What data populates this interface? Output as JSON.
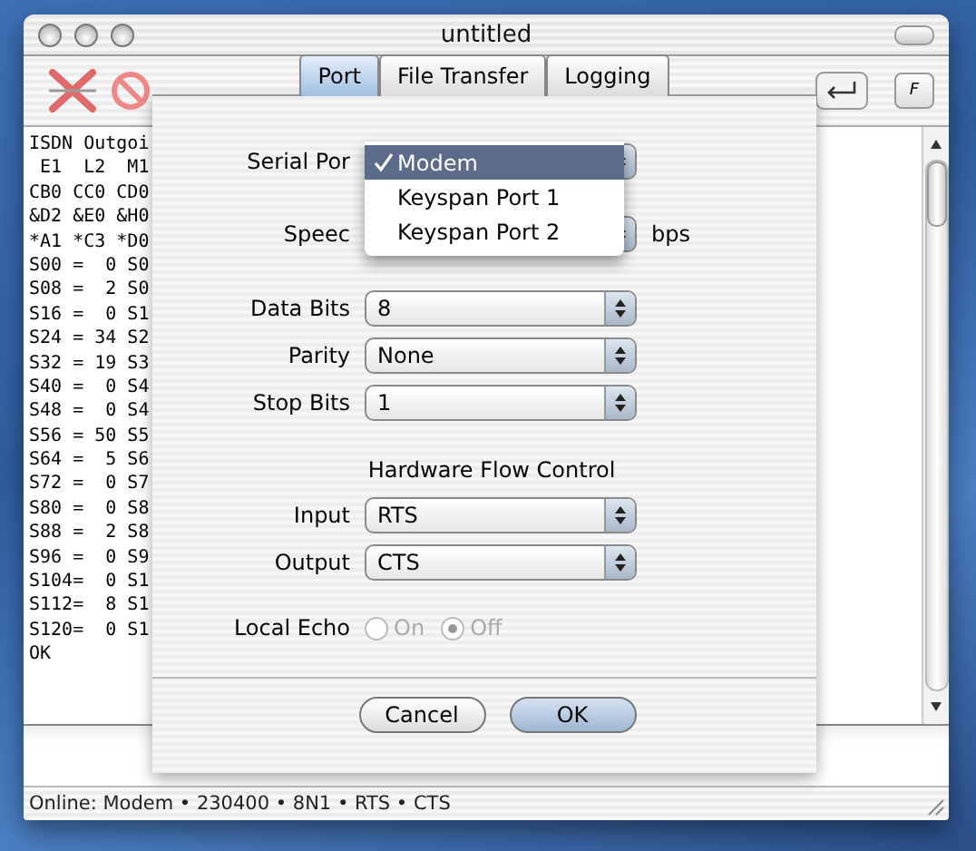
{
  "window": {
    "title": "untitled"
  },
  "toolbar": {
    "key_label": "F"
  },
  "terminal": {
    "lines": [
      "ISDN Outgoi",
      " E1  L2  M1",
      "CB0 CC0 CD0",
      "&D2 &E0 &H0",
      "*A1 *C3 *D0",
      "S00 =  0 S0",
      "S08 =  2 S0",
      "S16 =  0 S1",
      "S24 = 34 S2",
      "S32 = 19 S3",
      "S40 =  0 S4",
      "S48 =  0 S4",
      "S56 = 50 S5",
      "S64 =  5 S6",
      "S72 =  0 S7",
      "S80 =  0 S8",
      "S88 =  2 S8",
      "S96 =  0 S9",
      "S104=  0 S1",
      "S112=  8 S1",
      "S120=  0 S1",
      "OK"
    ]
  },
  "status_bar": "Online: Modem • 230400 • 8N1 • RTS • CTS",
  "sheet": {
    "tabs": [
      {
        "label": "Port",
        "selected": true
      },
      {
        "label": "File Transfer",
        "selected": false
      },
      {
        "label": "Logging",
        "selected": false
      }
    ],
    "port_rows": [
      {
        "label": "Serial Por"
      },
      {
        "label": "Speec",
        "unit": "bps"
      }
    ],
    "menu": {
      "items": [
        {
          "label": "Modem",
          "selected": true,
          "checked": true
        },
        {
          "label": "Keyspan Port 1",
          "selected": false,
          "checked": false
        },
        {
          "label": "Keyspan Port 2",
          "selected": false,
          "checked": false
        }
      ]
    },
    "serial_rows": [
      {
        "label": "Data Bits",
        "value": "8"
      },
      {
        "label": "Parity",
        "value": "None"
      },
      {
        "label": "Stop Bits",
        "value": "1"
      }
    ],
    "flow_control": {
      "heading": "Hardware Flow Control",
      "rows": [
        {
          "label": "Input",
          "value": "RTS"
        },
        {
          "label": "Output",
          "value": "CTS"
        }
      ]
    },
    "local_echo": {
      "label": "Local Echo",
      "disabled": true,
      "options": [
        {
          "label": "On",
          "selected": false
        },
        {
          "label": "Off",
          "selected": true
        }
      ]
    },
    "buttons": [
      {
        "label": "Cancel",
        "default": false
      },
      {
        "label": "OK",
        "default": true
      }
    ]
  }
}
